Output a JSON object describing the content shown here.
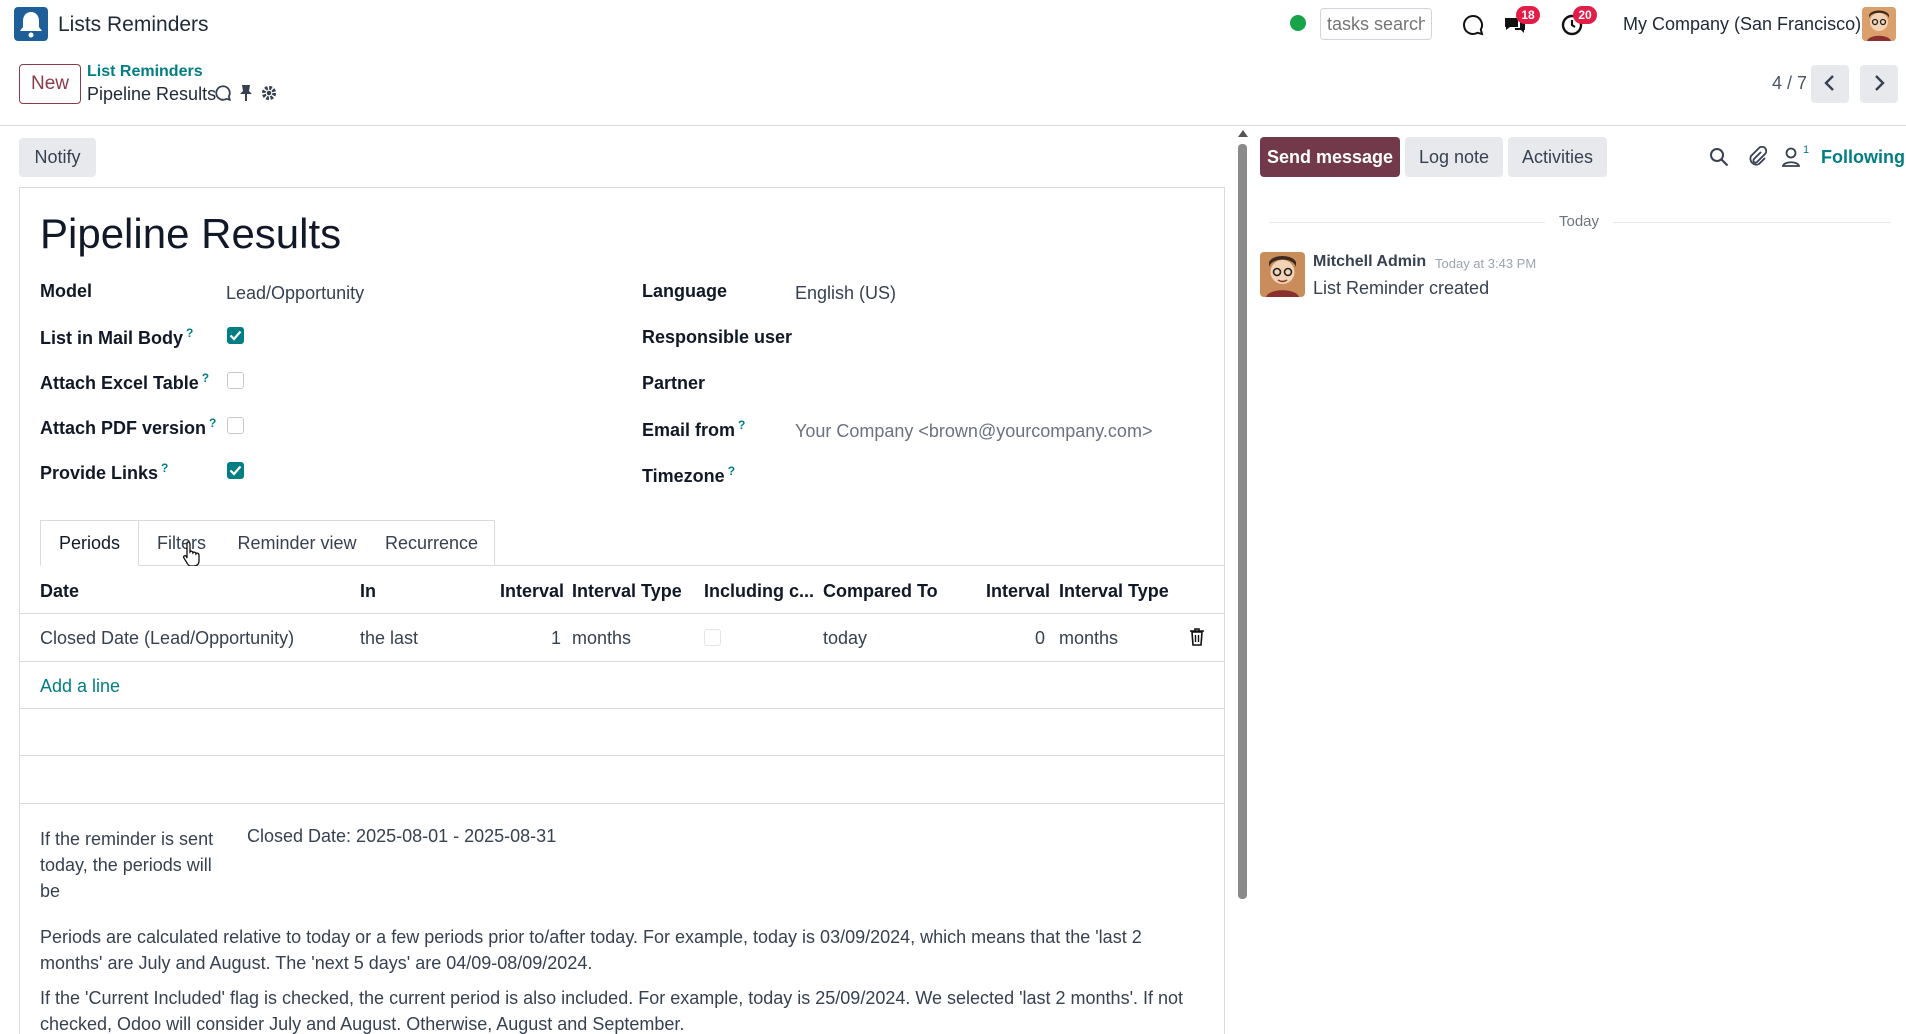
{
  "navbar": {
    "app_title": "Lists Reminders",
    "search_placeholder": "tasks search",
    "messages_count": "18",
    "activities_count": "20",
    "company": "My Company (San Francisco)"
  },
  "control_panel": {
    "new_label": "New",
    "breadcrumb_parent": "List Reminders",
    "breadcrumb_current": "Pipeline Results",
    "pager_value": "4 / 7"
  },
  "form": {
    "notify_label": "Notify",
    "title": "Pipeline Results",
    "left_fields": [
      {
        "label": "Model",
        "value": "Lead/Opportunity"
      },
      {
        "label": "List in Mail Body",
        "help": "?",
        "checked": true
      },
      {
        "label": "Attach Excel Table",
        "help": "?",
        "checked": false
      },
      {
        "label": "Attach PDF version",
        "help": "?",
        "checked": false
      },
      {
        "label": "Provide Links",
        "help": "?",
        "checked": true
      }
    ],
    "right_fields": [
      {
        "label": "Language",
        "value": "English (US)"
      },
      {
        "label": "Responsible user",
        "value": ""
      },
      {
        "label": "Partner",
        "value": ""
      },
      {
        "label": "Email from",
        "help": "?",
        "value": "Your Company <brown@yourcompany.com>"
      },
      {
        "label": "Timezone",
        "help": "?",
        "value": ""
      }
    ],
    "tabs": [
      "Periods",
      "Filters",
      "Reminder view",
      "Recurrence"
    ],
    "active_tab": "Periods",
    "table": {
      "headers": [
        "Date",
        "In",
        "Interval",
        "Interval Type",
        "Including c...",
        "Compared To",
        "Interval",
        "Interval Type"
      ],
      "rows": [
        {
          "date": "Closed Date (Lead/Opportunity)",
          "in": "the last",
          "interval": "1",
          "interval_type": "months",
          "including_current": false,
          "compared_to": "today",
          "interval2": "0",
          "interval_type2": "months"
        }
      ],
      "add_line": "Add a line"
    },
    "help": {
      "label": "If the reminder is sent today, the periods will be",
      "value": "Closed Date: 2025-08-01 - 2025-08-31",
      "para1": "Periods are calculated relative to today or a few periods prior to/after today. For example, today is 03/09/2024, which means that the 'last 2 months' are July and August. The 'next 5 days' are 04/09-08/09/2024.",
      "para2": "If the 'Current Included' flag is checked, the current period is also included. For example, today is 25/09/2024. We selected 'last 2 months'. If not checked, Odoo will consider July and August. Otherwise, August and September."
    }
  },
  "chatter": {
    "send_message": "Send message",
    "log_note": "Log note",
    "activities": "Activities",
    "follower_count": "1",
    "following": "Following",
    "date_separator": "Today",
    "messages": [
      {
        "author": "Mitchell Admin",
        "date": "Today at 3:43 PM",
        "body": "List Reminder created"
      }
    ]
  },
  "colors": {
    "primary": "#71394a",
    "teal": "#017e84",
    "badge": "#e11d48"
  }
}
